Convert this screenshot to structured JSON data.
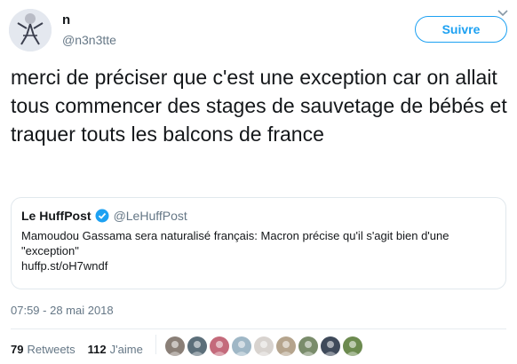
{
  "author": {
    "name": "n",
    "handle": "@n3n3tte",
    "follow_label": "Suivre"
  },
  "tweet": {
    "text": "merci de préciser que c'est une exception car on allait tous commencer des stages de sauvetage de bébés et traquer touts les balcons de france",
    "timestamp": "07:59 - 28 mai 2018"
  },
  "quoted": {
    "name": "Le HuffPost",
    "handle": "@LeHuffPost",
    "text": "Mamoudou Gassama sera naturalisé français: Macron précise qu'il s'agit bien d'une \"exception\"",
    "link": "huffp.st/oH7wndf"
  },
  "stats": {
    "retweets_count": "79",
    "retweets_label": "Retweets",
    "likes_count": "112",
    "likes_label": "J'aime"
  },
  "likers": [
    "#8a7f77",
    "#5c6f7a",
    "#c46a7b",
    "#9fb7c6",
    "#d8d3cf",
    "#b5a48d",
    "#7a8c6b",
    "#3f4a5a",
    "#6c8a4f"
  ],
  "colors": {
    "accent": "#1da1f2",
    "secondary": "#657786",
    "border": "#e1e8ed"
  }
}
